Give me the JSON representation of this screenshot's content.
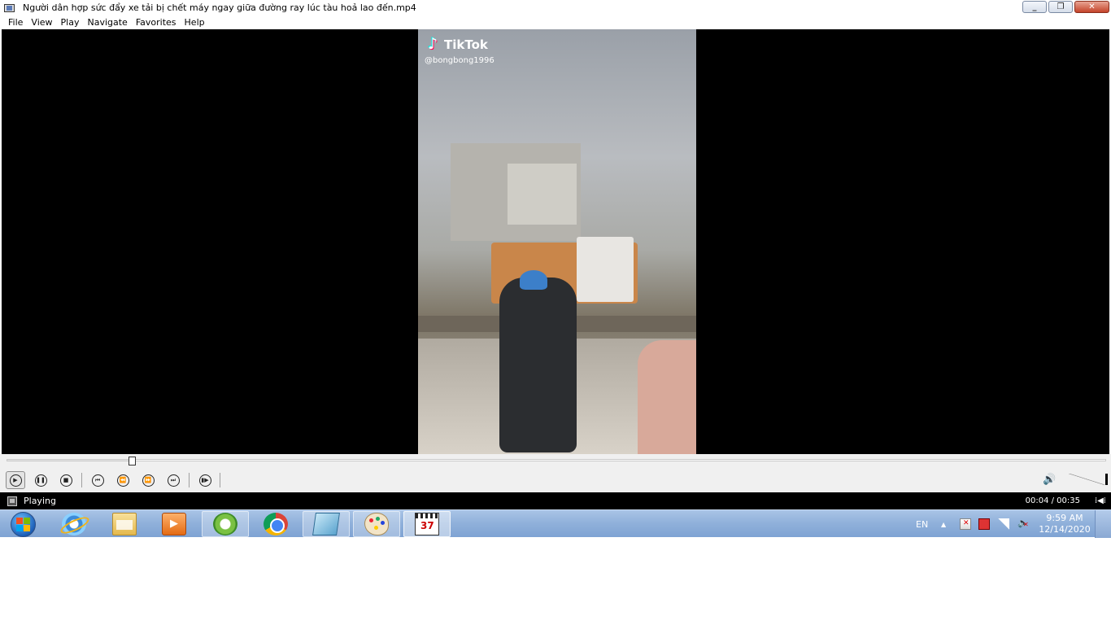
{
  "window": {
    "title": "Người dân hợp sức đẩy xe tải bị chết máy ngay giữa đường ray lúc tàu hoả lao đến.mp4"
  },
  "menu": [
    {
      "label": "File"
    },
    {
      "label": "View"
    },
    {
      "label": "Play"
    },
    {
      "label": "Navigate"
    },
    {
      "label": "Favorites"
    },
    {
      "label": "Help"
    }
  ],
  "video": {
    "brand": "TikTok",
    "handle": "@bongbong1996"
  },
  "playback": {
    "progress": 0.114,
    "volume": 1.0
  },
  "status": {
    "state": "Playing",
    "time": "00:04 / 00:35"
  },
  "taskbar": {
    "apps": [
      "start-button",
      "internet-explorer",
      "windows-explorer",
      "windows-media-player",
      "coc-coc-browser",
      "google-chrome",
      "notebook-app",
      "paint",
      "media-player-classic"
    ]
  },
  "tray": {
    "language": "EN",
    "time": "9:59 AM",
    "date": "12/14/2020"
  }
}
